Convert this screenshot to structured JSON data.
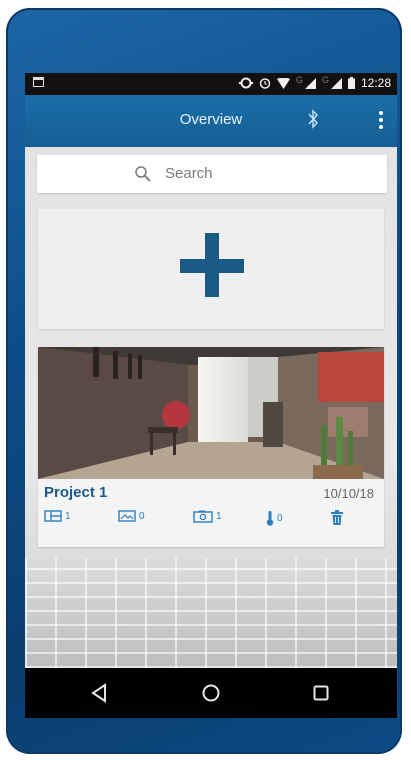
{
  "status_bar": {
    "time": "12:28",
    "network_label_1": "G",
    "network_label_2": "G"
  },
  "app_bar": {
    "title": "Overview",
    "bluetooth_icon": "bluetooth-icon",
    "menu_icon": "more-vert-icon"
  },
  "search": {
    "placeholder": "Search"
  },
  "add_project": {
    "icon": "plus-icon"
  },
  "project": {
    "name": "Project 1",
    "date": "10/10/18",
    "stats": [
      {
        "icon": "floorplan-icon",
        "count": "1"
      },
      {
        "icon": "image-icon",
        "count": "0"
      },
      {
        "icon": "camera-icon",
        "count": "1"
      },
      {
        "icon": "thermometer-icon",
        "count": "0"
      }
    ],
    "delete_icon": "trash-icon"
  },
  "navigation": {
    "back_icon": "back-triangle-icon",
    "home_icon": "home-circle-icon",
    "recents_icon": "recents-square-icon"
  },
  "colors": {
    "accent": "#1a5a85",
    "app_bar": "#155f93",
    "stat_blue": "#2a7fc2"
  }
}
